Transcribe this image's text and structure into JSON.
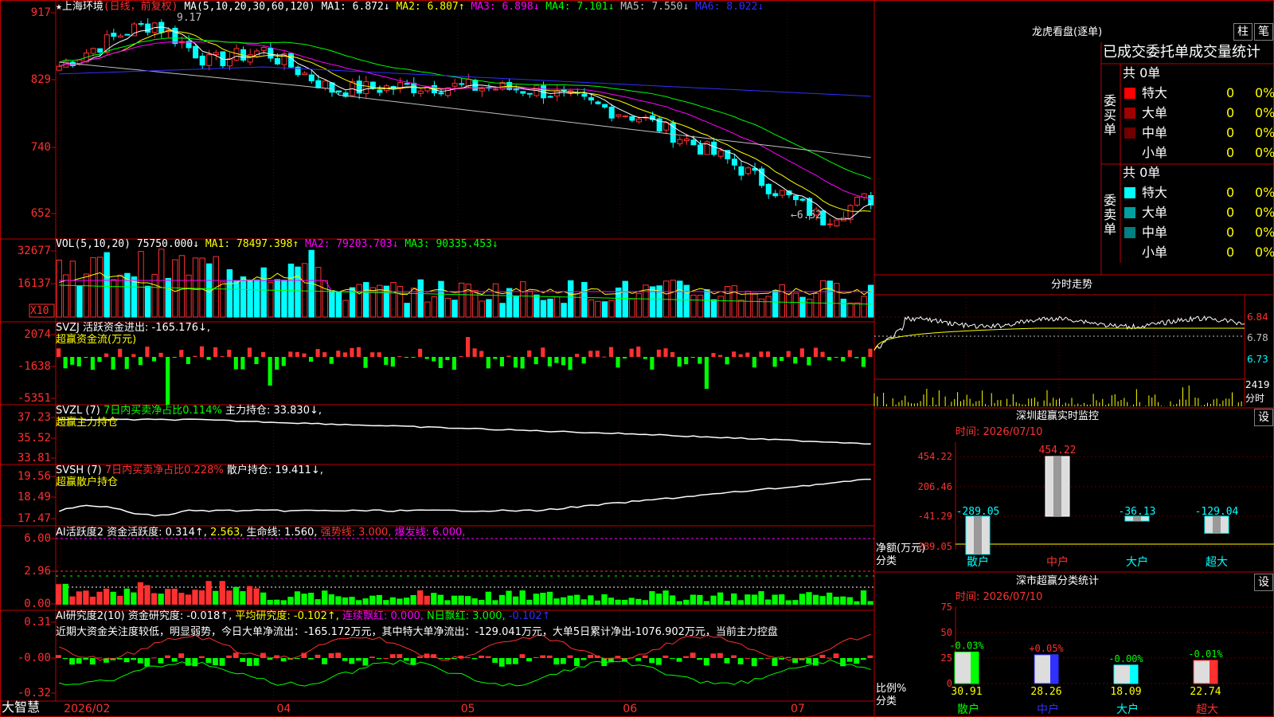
{
  "colors": {
    "up": "#ff3030",
    "down": "#00ffff",
    "vol_up": "#ff3030",
    "vol_down": "#00ffff",
    "ma1": "#ffff00",
    "ma2": "#ff00ff",
    "ma3": "#00ff00",
    "ma4": "#00c000",
    "ma5": "#c0c0c0",
    "ma6": "#3030ff",
    "grid": "#c00000",
    "text": "#c0c0c0",
    "yellow": "#ffff00",
    "green": "#00ff00",
    "red": "#ff3030",
    "white": "#ffffff"
  },
  "stock": {
    "title_star": "★",
    "name": "上海环境",
    "mode": "(日线，前复权)",
    "ma_label": "MA(5,10,20,30,60,120)",
    "ma": [
      {
        "label": "MA1:",
        "value": "6.872",
        "arrow": "↓",
        "color": "#ffffff"
      },
      {
        "label": "MA2:",
        "value": "6.807",
        "arrow": "↑",
        "color": "#ffff00"
      },
      {
        "label": "MA3:",
        "value": "6.898",
        "arrow": "↓",
        "color": "#ff00ff"
      },
      {
        "label": "MA4:",
        "value": "7.101",
        "arrow": "↓",
        "color": "#00ff00"
      },
      {
        "label": "MA5:",
        "value": "7.550",
        "arrow": "↓",
        "color": "#c0c0c0"
      },
      {
        "label": "MA6:",
        "value": "8.022",
        "arrow": "↓",
        "color": "#3030ff"
      }
    ],
    "yticks": [
      "917",
      "829",
      "740",
      "652"
    ],
    "high_label": "9.17",
    "low_label": "←6.52"
  },
  "vol": {
    "label": "VOL(5,10,20)",
    "value": "75750.000↓",
    "ma": [
      {
        "t": "MA1: 78497.398↑",
        "c": "#ffff00"
      },
      {
        "t": "MA2: 79203.703↓",
        "c": "#ff00ff"
      },
      {
        "t": "MA3: 90335.453↓",
        "c": "#00ff00"
      }
    ],
    "yticks": [
      "32677",
      "16137"
    ],
    "unit": "X10"
  },
  "svzj": {
    "label": "SVZJ",
    "desc": "活跃资金进出: -165.176↓,",
    "sub": "超赢资金流(万元)",
    "yticks": [
      "2074",
      "-1638",
      "-5351"
    ]
  },
  "svzl": {
    "label": "SVZL (7)",
    "a": "7日内买卖净占比0.114%",
    "b": "主力持仓: 33.830↓,",
    "sub": "超赢主力持仓",
    "yticks": [
      "37.23",
      "35.52",
      "33.81"
    ]
  },
  "svsh": {
    "label": "SVSH (7)",
    "a": "7日内买卖净占比0.228%",
    "b": "散户持仓: 19.411↓,",
    "sub": "超赢散户持仓",
    "yticks": [
      "19.56",
      "18.49",
      "17.47"
    ]
  },
  "ai1": {
    "label": "AI活跃度2",
    "a": "资金活跃度: 0.314↑,",
    "b": "2.563,",
    "c": "生命线: 1.560,",
    "d": "强势线: 3.000,",
    "e": "爆发线: 6.000,",
    "yticks": [
      "6.00",
      "2.96",
      "0.00"
    ]
  },
  "ai2": {
    "label": "AI研究度2(10)",
    "a": "资金研究度: -0.018↑,",
    "b": "平均研究度: -0.102↑,",
    "c": "连续飘红: 0.000,",
    "d": "N日飘红: 3.000,",
    "e": "-0.102↑",
    "desc": "近期大资金关注度较低，明显弱势，今日大单净流出：-165.172万元，其中特大单净流出：-129.041万元，大单5日累计净出-1076.902万元，当前主力控盘",
    "yticks": [
      "0.31",
      "-0.00",
      "-0.32"
    ]
  },
  "xaxis": {
    "labels": [
      "2026/02",
      "04",
      "05",
      "06",
      "07"
    ]
  },
  "brand": "大智慧",
  "right": {
    "lhb_title": "龙虎看盘(逐单)",
    "btn_zhu": "柱",
    "btn_bi": "笔",
    "table_title": "已成交委托单成交量统计",
    "buy_label": "委买单",
    "sell_label": "委卖单",
    "buy_total": "共 0单",
    "sell_total": "共 0单",
    "buy_rows": [
      {
        "name": "特大",
        "n": "0",
        "p": "0%",
        "c": "#ff0000"
      },
      {
        "name": "大单",
        "n": "0",
        "p": "0%",
        "c": "#a00000"
      },
      {
        "name": "中单",
        "n": "0",
        "p": "0%",
        "c": "#700000"
      },
      {
        "name": "小单",
        "n": "0",
        "p": "0%",
        "c": ""
      }
    ],
    "sell_rows": [
      {
        "name": "特大",
        "n": "0",
        "p": "0%",
        "c": "#00ffff"
      },
      {
        "name": "大单",
        "n": "0",
        "p": "0%",
        "c": "#00a0a0"
      },
      {
        "name": "中单",
        "n": "0",
        "p": "0%",
        "c": "#008080"
      },
      {
        "name": "小单",
        "n": "0",
        "p": "0%",
        "c": ""
      }
    ],
    "fs_title": "分时走势",
    "fs_prices": [
      "6.84",
      "6.78",
      "6.73"
    ],
    "fs_vol": "2419",
    "fs_vol_label": "分时",
    "sz_title": "深圳超赢实时监控",
    "sz_btn": "设",
    "sz_time": "时间: 2026/07/10",
    "sz_yticks": [
      "454.22",
      "206.46",
      "-41.29",
      "-289.05"
    ],
    "sz_ylabel": "净额(万元)",
    "sz_xlabel": "分类",
    "sz_bars": [
      {
        "cat": "散户",
        "v": -289.05,
        "label": "-289.05"
      },
      {
        "cat": "中户",
        "v": 454.22,
        "label": "454.22"
      },
      {
        "cat": "大户",
        "v": -36.13,
        "label": "-36.13"
      },
      {
        "cat": "超大",
        "v": -129.04,
        "label": "-129.04"
      }
    ],
    "fl_title": "深市超赢分类统计",
    "fl_btn": "设",
    "fl_time": "时间: 2026/07/10",
    "fl_yticks": [
      "75",
      "50",
      "25",
      "0"
    ],
    "fl_ylabel": "比例%",
    "fl_xlabel": "分类",
    "fl_bars": [
      {
        "cat": "散户",
        "v": 30.91,
        "label": "30.91",
        "chg": "-0.03%",
        "color": "#00ff00"
      },
      {
        "cat": "中户",
        "v": 28.26,
        "label": "28.26",
        "chg": "+0.05%",
        "color": "#3030ff"
      },
      {
        "cat": "大户",
        "v": 18.09,
        "label": "18.09",
        "chg": "-0.00%",
        "color": "#00ffff"
      },
      {
        "cat": "超大",
        "v": 22.74,
        "label": "22.74",
        "chg": "-0.01%",
        "color": "#ff3030"
      }
    ]
  }
}
